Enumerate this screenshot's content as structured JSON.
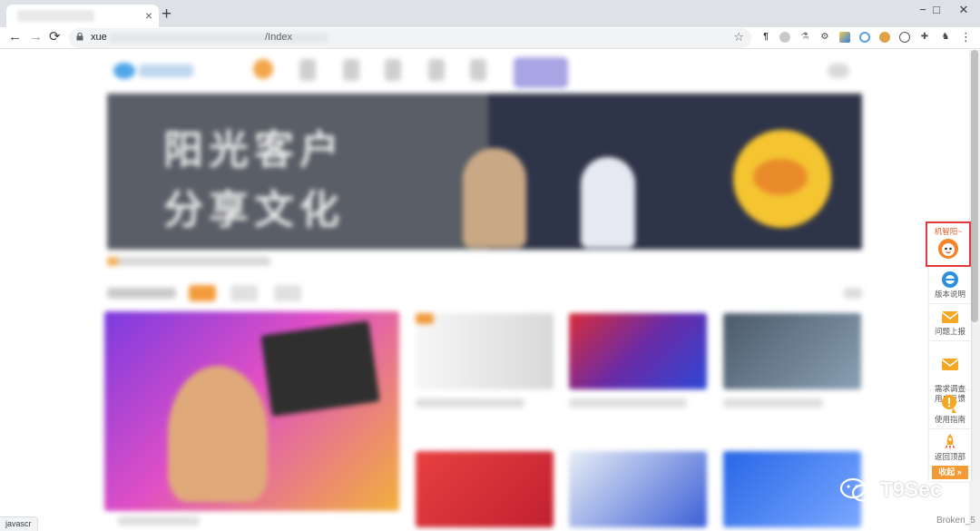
{
  "browser": {
    "tab_title": "",
    "close_tab_glyph": "×",
    "new_tab_glyph": "+",
    "window_controls": {
      "minimize": "−",
      "maximize": "□",
      "close": "✕"
    },
    "nav": {
      "back": "←",
      "forward": "→",
      "reload": "⟳"
    },
    "url_prefix": "xue",
    "url_suffix": "/Index",
    "bookmark_glyph": "☆",
    "extension_icons": [
      "pilcrow-icon",
      "circle-icon",
      "flask-icon",
      "gear-icon",
      "puzzle-color-icon",
      "ring-icon",
      "cookie-icon",
      "face-icon",
      "puzzle-icon",
      "user-icon"
    ],
    "menu_glyph": "⋮"
  },
  "page": {
    "banner": {
      "line1": "阳光客户",
      "line2": "分享文化"
    }
  },
  "float_bar": {
    "items": [
      {
        "label": "机智阳~",
        "icon": "sun-mascot-icon",
        "highlight": true
      },
      {
        "label": "版本说明",
        "icon": "ie-logo-icon"
      },
      {
        "label": "问题上报",
        "icon": "envelope-icon"
      },
      {
        "label": "需求调查\n用户反馈",
        "icon": "envelope-icon"
      },
      {
        "label": "使用指南",
        "icon": "info-hand-icon"
      },
      {
        "label": "返回顶部",
        "icon": "rocket-icon"
      }
    ],
    "collapse_label": "收起 »"
  },
  "status_bar": {
    "left": "javascr",
    "right": "Broken_5"
  },
  "watermark": "T9Sec",
  "colors": {
    "highlight_border": "#e23b3b",
    "accent_orange": "#f29a33",
    "chrome_tabstrip": "#dee1e6"
  }
}
